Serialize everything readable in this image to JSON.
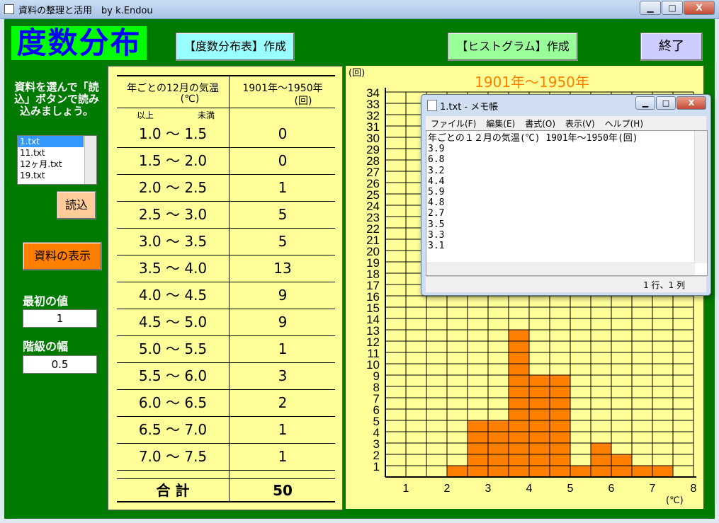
{
  "window": {
    "title": "資料の整理と活用　by k.Endou",
    "min": "▁",
    "max": "□",
    "close": "X"
  },
  "header": {
    "title": "度数分布"
  },
  "buttons": {
    "make_table": "【度数分布表】作成",
    "make_histogram": "【ヒストグラム】作成",
    "quit": "終了",
    "load": "読込",
    "show_data": "資料の表示"
  },
  "sidebar": {
    "instruction": "資料を選んで「読込」ボタンで読み込みましょう。",
    "files": [
      "1.txt",
      "11.txt",
      "12ヶ月.txt",
      "19.txt"
    ],
    "first_value_label": "最初の値",
    "first_value": "1",
    "width_label": "階級の幅",
    "width_value": "0.5"
  },
  "freq_table": {
    "col1_header": "年ごとの12月の気温",
    "col1_unit": "(℃)",
    "col2_header": "1901年〜1950年",
    "col2_unit": "(回)",
    "sub_lower": "以上",
    "sub_upper": "未満",
    "rows": [
      {
        "range": "1.0 〜 1.5",
        "count": "0"
      },
      {
        "range": "1.5 〜 2.0",
        "count": "0"
      },
      {
        "range": "2.0 〜 2.5",
        "count": "1"
      },
      {
        "range": "2.5 〜 3.0",
        "count": "5"
      },
      {
        "range": "3.0 〜 3.5",
        "count": "5"
      },
      {
        "range": "3.5 〜 4.0",
        "count": "13"
      },
      {
        "range": "4.0 〜 4.5",
        "count": "9"
      },
      {
        "range": "4.5 〜 5.0",
        "count": "9"
      },
      {
        "range": "5.0 〜 5.5",
        "count": "1"
      },
      {
        "range": "5.5 〜 6.0",
        "count": "3"
      },
      {
        "range": "6.0 〜 6.5",
        "count": "2"
      },
      {
        "range": "6.5 〜 7.0",
        "count": "1"
      },
      {
        "range": "7.0 〜 7.5",
        "count": "1"
      }
    ],
    "total_label": "合 計",
    "total_value": "50"
  },
  "chart_data": {
    "type": "bar",
    "title": "1901年〜1950年",
    "ylabel": "(回)",
    "xlabel": "(℃)",
    "categories": [
      "1.0-1.5",
      "1.5-2.0",
      "2.0-2.5",
      "2.5-3.0",
      "3.0-3.5",
      "3.5-4.0",
      "4.0-4.5",
      "4.5-5.0",
      "5.0-5.5",
      "5.5-6.0",
      "6.0-6.5",
      "6.5-7.0",
      "7.0-7.5"
    ],
    "bin_starts": [
      1.0,
      1.5,
      2.0,
      2.5,
      3.0,
      3.5,
      4.0,
      4.5,
      5.0,
      5.5,
      6.0,
      6.5,
      7.0
    ],
    "bin_width": 0.5,
    "values": [
      0,
      0,
      1,
      5,
      5,
      13,
      9,
      9,
      1,
      3,
      2,
      1,
      1
    ],
    "xlim": [
      0.5,
      8
    ],
    "ylim": [
      0,
      34
    ],
    "x_ticks": [
      "1",
      "2",
      "3",
      "4",
      "5",
      "6",
      "7",
      "8"
    ],
    "y_ticks": [
      "1",
      "2",
      "3",
      "4",
      "5",
      "6",
      "7",
      "8",
      "9",
      "10",
      "11",
      "12",
      "13",
      "14",
      "15",
      "16",
      "17",
      "18",
      "19",
      "20",
      "21",
      "22",
      "23",
      "24",
      "25",
      "26",
      "27",
      "28",
      "29",
      "30",
      "31",
      "32",
      "33",
      "34"
    ],
    "bar_color": "#ff7f00",
    "grid": true
  },
  "notepad": {
    "title": "1.txt - メモ帳",
    "menu": [
      "ファイル(F)",
      "編集(E)",
      "書式(O)",
      "表示(V)",
      "ヘルプ(H)"
    ],
    "lines": [
      "年ごとの１２月の気温(℃) 1901年～1950年(回)",
      "3.9",
      "6.8",
      "3.2",
      "4.4",
      "5.9",
      "4.8",
      "2.7",
      "3.5",
      "3.3",
      "3.1"
    ],
    "status": "1 行、1 列"
  }
}
